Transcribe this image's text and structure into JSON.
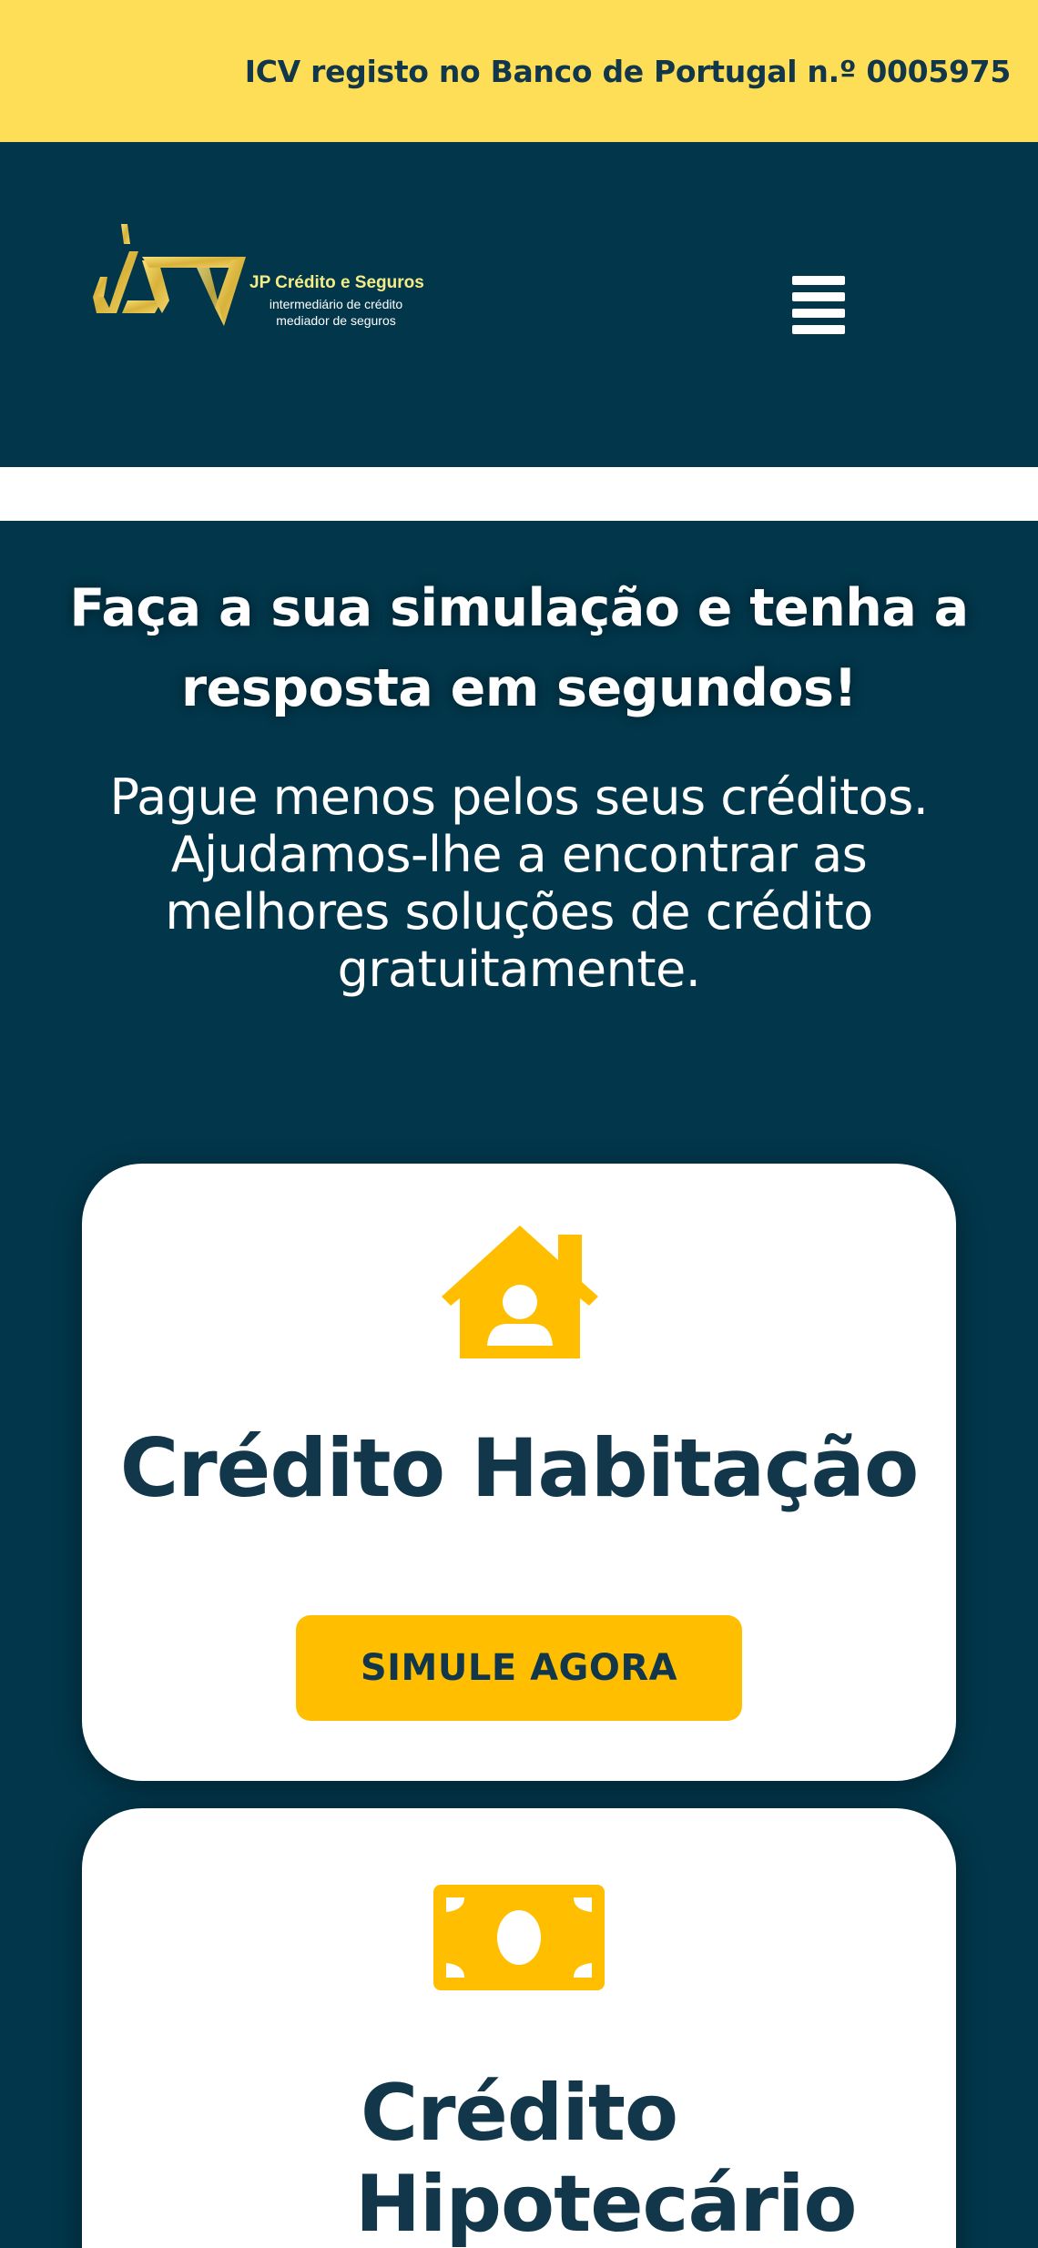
{
  "topbar": {
    "notice": "ICV registo no Banco de Portugal n.º 0005975"
  },
  "header": {
    "logo_title": "JP Crédito e Seguros",
    "logo_line1": "intermediário de crédito",
    "logo_line2": "mediador de seguros",
    "menu_icon": "hamburger-icon"
  },
  "hero": {
    "title": "Faça a sua simulação e tenha a resposta em segundos!",
    "subtitle": "Pague menos pelos seus créditos. Ajudamos-lhe a encontrar as melhores soluções de crédito gratuitamente."
  },
  "cards": [
    {
      "icon": "house-user-icon",
      "title": "Crédito Habitação",
      "button_label": "SIMULE AGORA"
    },
    {
      "icon": "money-bill-icon",
      "title": "Crédito Hipotecário"
    }
  ],
  "colors": {
    "topbar_bg": "#fede57",
    "navy": "#02364a",
    "accent_yellow": "#ffbf00",
    "text_dark": "#12364a"
  }
}
